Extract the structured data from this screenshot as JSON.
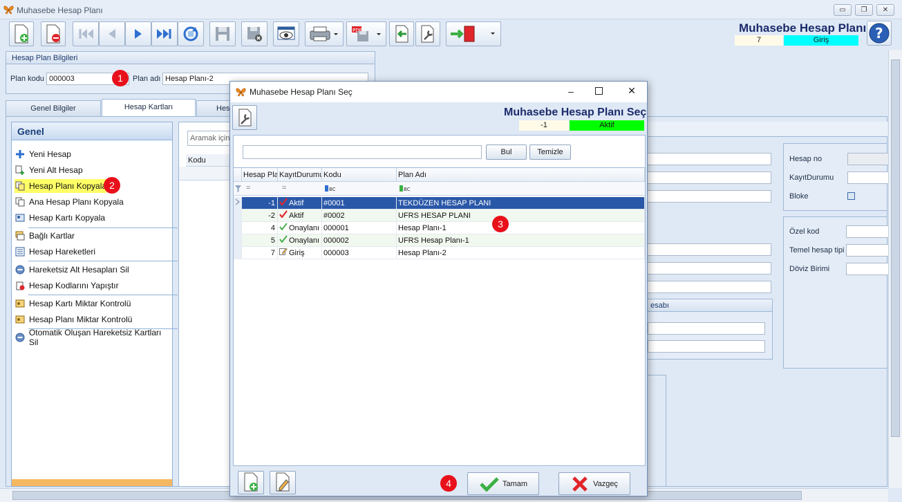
{
  "window": {
    "title": "Muhasebe Hesap Planı",
    "minimize": "▭",
    "restore": "❐",
    "close": "✕"
  },
  "header": {
    "heading": "Muhasebe Hesap Planı",
    "status_number": "7",
    "status_text": "Giriş",
    "status_color": "#00ffff"
  },
  "plan_info": {
    "group_title": "Hesap Plan Bilgileri",
    "code_label": "Plan kodu",
    "code_value": "000003",
    "name_label": "Plan adı",
    "name_value": "Hesap Planı-2"
  },
  "tabs": [
    "Genel Bilgiler",
    "Hesap Kartları",
    "Hesa"
  ],
  "left_panel": {
    "title": "Genel",
    "items": [
      "Yeni Hesap",
      "Yeni Alt Hesap",
      "Hesap Planı Kopyala",
      "Ana Hesap Planı Kopyala",
      "Hesap Kartı Kopyala",
      "Bağlı Kartlar",
      "Hesap Hareketleri",
      "Hareketsiz Alt Hesapları Sil",
      "Hesap Kodlarını Yapıştır",
      "Hesap Kartı Miktar Kontrolü",
      "Hesap Planı Miktar Kontrolü",
      "Otomatik Oluşan Hareketsiz Kartları Sil"
    ],
    "highlight_color": "#ffff66"
  },
  "middle": {
    "search_placeholder": "Aramak için",
    "col_code": "Kodu"
  },
  "right_panel": {
    "labels": [
      "Hesap no",
      "KayıtDurumu",
      "Bloke",
      "Özel kod",
      "Temel hesap tipi",
      "Döviz Birimi"
    ],
    "group_fragment": "esabı"
  },
  "badges": [
    "1",
    "2",
    "3",
    "4"
  ],
  "dialog": {
    "title": "Muhasebe Hesap Planı Seç",
    "heading": "Muhasebe Hesap Planı Seç",
    "status_number": "-1",
    "status_text": "Aktif",
    "status_color": "#00ff00",
    "find_button": "Bul",
    "clear_button": "Temizle",
    "columns": [
      "Hesap Pla",
      "KayıtDurumu",
      "Kodu",
      "Plan Adı"
    ],
    "filter_eq": "=",
    "rows": [
      {
        "no": "-1",
        "status": "Aktif",
        "code": "#0001",
        "name": "TEKDÜZEN HESAP PLANI",
        "icon": "red-check-icon"
      },
      {
        "no": "-2",
        "status": "Aktif",
        "code": "#0002",
        "name": "UFRS HESAP PLANI",
        "icon": "red-check-icon"
      },
      {
        "no": "4",
        "status": "Onaylanı",
        "code": "000001",
        "name": "Hesap Planı-1",
        "icon": "green-check-icon"
      },
      {
        "no": "5",
        "status": "Onaylanı",
        "code": "000002",
        "name": "UFRS Hesap Planı-1",
        "icon": "green-check-icon"
      },
      {
        "no": "7",
        "status": "Giriş",
        "code": "000003",
        "name": "Hesap Planı-2",
        "icon": "edit-icon"
      }
    ],
    "ok_button": "Tamam",
    "cancel_button": "Vazgeç"
  }
}
